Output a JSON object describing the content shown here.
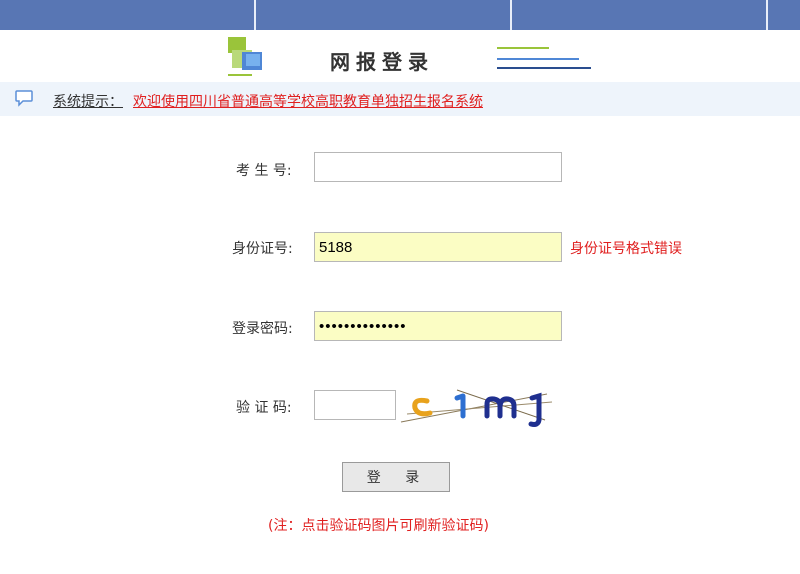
{
  "header": {
    "title": "网报登录"
  },
  "notice": {
    "label": "系统提示：",
    "message": "欢迎使用四川省普通高等学校高职教育单独招生报名系统",
    "icon": "chat-bubble-icon"
  },
  "form": {
    "candidate_no": {
      "label": "考 生 号:",
      "value": ""
    },
    "id_card": {
      "label": "身份证号:",
      "value": "5188",
      "error": "身份证号格式错误"
    },
    "password": {
      "label": "登录密码:",
      "value": "••••••••••••••"
    },
    "captcha": {
      "label": "验 证 码:",
      "value": "",
      "image_text": "c1mj"
    },
    "submit_label": "登 录",
    "note": "(注：点击验证码图片可刷新验证码)"
  },
  "colors": {
    "topbar": "#5876b4",
    "notice_bg": "#eef4fb",
    "error": "#e02020",
    "field_autofill": "#fbfdc4"
  }
}
